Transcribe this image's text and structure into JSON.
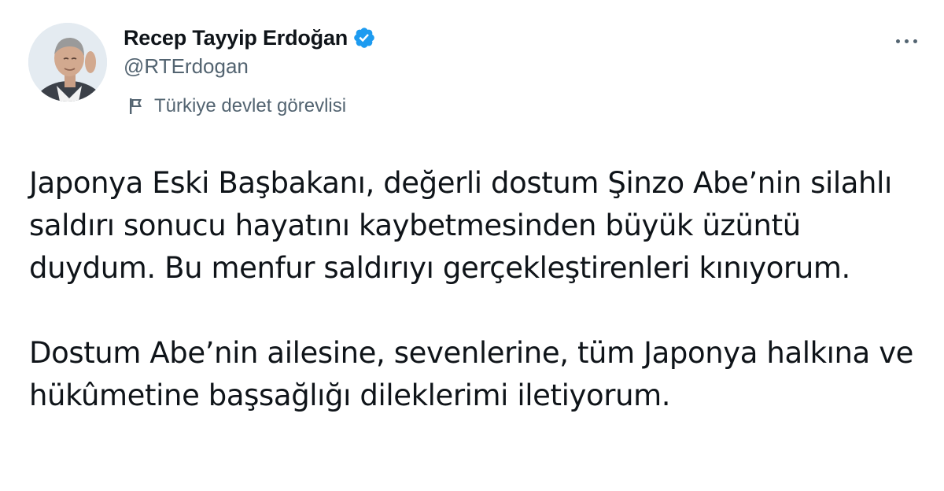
{
  "author": {
    "display_name": "Recep Tayyip Erdoğan",
    "handle": "@RTErdogan",
    "verified": true,
    "avatar_icon": "profile-photo",
    "label": "Türkiye devlet görevlisi",
    "label_icon": "flag-icon"
  },
  "tweet": {
    "paragraphs": [
      "Japonya Eski Başbakanı, değerli dostum Şinzo Abe’nin silahlı saldırı sonucu hayatını kaybetmesinden büyük üzüntü duydum. Bu menfur saldırıyı gerçekleştirenleri kınıyorum.",
      "Dostum Abe’nin ailesine, sevenlerine, tüm Japonya halkına ve hükûmetine başsağlığı dileklerimi iletiyorum."
    ]
  },
  "colors": {
    "text": "#0f1419",
    "secondary": "#536471",
    "verified_badge": "#1d9bf0"
  },
  "menu": {
    "icon": "more-options-icon"
  }
}
